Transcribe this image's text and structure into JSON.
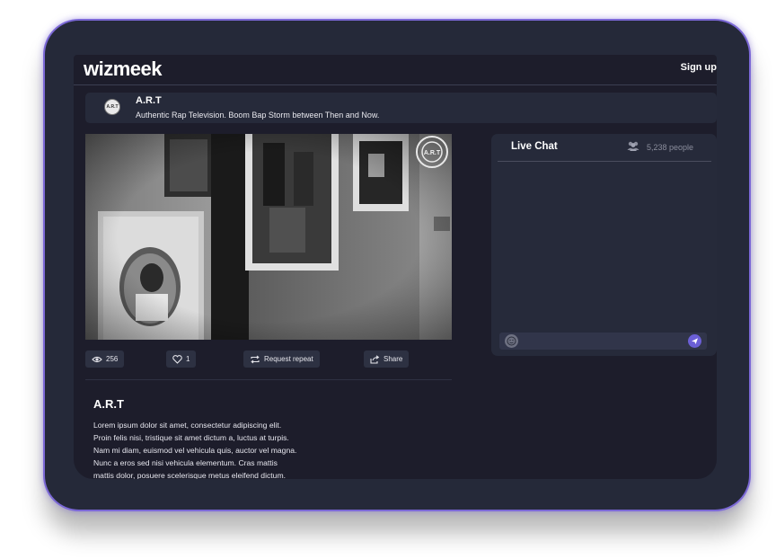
{
  "header": {
    "logo": "wizmeek",
    "signup_label": "Sign up"
  },
  "channel": {
    "logo_text": "A.R.T",
    "name": "A.R.T",
    "description": "Authentic Rap Television. Boom Bap Storm between Then and Now."
  },
  "video": {
    "watermark_text": "A.R.T"
  },
  "actions": {
    "views": "256",
    "likes": "1",
    "request_repeat_label": "Request repeat",
    "share_label": "Share"
  },
  "description": {
    "title": "A.R.T",
    "lines": [
      "Lorem ipsum dolor sit amet, consectetur adipiscing elit.",
      "Proin felis nisi, tristique sit amet dictum a, luctus at turpis.",
      "Nam mi diam, euismod vel vehicula quis, auctor vel magna.",
      "Nunc a eros sed nisi vehicula elementum. Cras mattis",
      "mattis dolor, posuere scelerisque metus eleifend dictum."
    ]
  },
  "chat": {
    "title": "Live Chat",
    "people_count": "5,238 people",
    "input_placeholder": ""
  },
  "icons": {
    "views": "eye-icon",
    "likes": "heart-icon",
    "repeat": "repeat-icon",
    "share": "share-icon",
    "people": "people-icon",
    "emoji": "emoji-icon",
    "send": "send-icon"
  },
  "colors": {
    "device_frame": "#252939",
    "screen_bg": "#1d1d2b",
    "panel_bg": "#262a3a",
    "accent": "#6b5fd6",
    "glow": "#7b68d6"
  }
}
